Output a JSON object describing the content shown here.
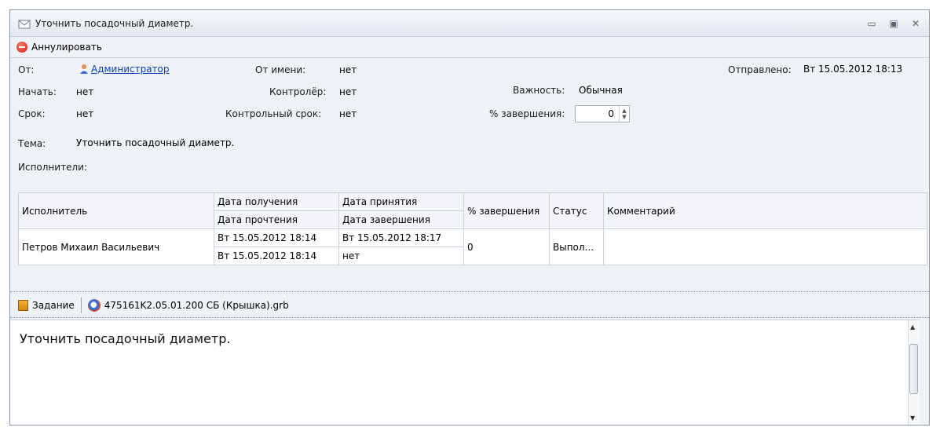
{
  "window": {
    "title": "Уточнить посадочный диаметр."
  },
  "toolbar": {
    "cancel_label": "Аннулировать"
  },
  "info": {
    "from_label": "От:",
    "from_value": "Администратор",
    "on_behalf_label": "От имени:",
    "on_behalf_value": "нет",
    "sent_label": "Отправлено:",
    "sent_value": "Вт 15.05.2012 18:13",
    "start_label": "Начать:",
    "start_value": "нет",
    "controller_label": "Контролёр:",
    "controller_value": "нет",
    "importance_label": "Важность:",
    "importance_value": "Обычная",
    "deadline_label": "Срок:",
    "deadline_value": "нет",
    "control_deadline_label": "Контрольный срок:",
    "control_deadline_value": "нет",
    "completion_label": "% завершения:",
    "completion_value": "0",
    "subject_label": "Тема:",
    "subject_value": "Уточнить посадочный диаметр.",
    "executors_label": "Исполнители:"
  },
  "grid": {
    "headers": {
      "executor": "Исполнитель",
      "received": "Дата получения",
      "read": "Дата прочтения",
      "accepted": "Дата принятия",
      "completed": "Дата завершения",
      "percent": "% завершения",
      "status": "Статус",
      "comment": "Комментарий"
    },
    "rows": [
      {
        "executor": "Петров Михаил Васильевич",
        "received": "Вт 15.05.2012 18:14",
        "read": "Вт 15.05.2012 18:14",
        "accepted": "Вт 15.05.2012 18:17",
        "completed": "нет",
        "percent": "0",
        "status": "Выпол...",
        "comment": ""
      }
    ]
  },
  "attachments": {
    "task_label": "Задание",
    "file_label": "475161K2.05.01.200 СБ (Крышка).grb"
  },
  "body_text": "Уточнить посадочный диаметр."
}
